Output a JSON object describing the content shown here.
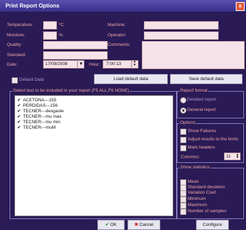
{
  "window": {
    "title": "Print Report Options",
    "close": "x"
  },
  "form": {
    "temperature_label": "Temperature:",
    "temperature_unit": "ºC",
    "moisture_label": "Moisture:",
    "moisture_unit": "%",
    "quality_label": "Quality:",
    "standard_label": "Standard:",
    "date_label": "Date:",
    "date_value": "17/09/2008",
    "hour_label": "Hour:",
    "hour_value": "7:00:13",
    "machine_label": "Machine:",
    "operator_label": "Operator:",
    "comments_label": "Comments:"
  },
  "defaults": {
    "default_data_label": "Default Data",
    "load_label": "Load default data",
    "save_label": "Save default data"
  },
  "tests": {
    "title": "Select test to be included in your report (F5 ALL,F6 NONE)",
    "items": [
      "ACETONA---155",
      "PERDIDAS---156",
      "TECNER---desgaste",
      "TECNER---mu max",
      "TECNER---mu min",
      "TECNER---muM"
    ]
  },
  "report_format": {
    "title": "Report format",
    "detailed": "Detailed report",
    "general": "General report"
  },
  "options": {
    "title": "Options",
    "show_failures": "Show Failures",
    "adjust": "Adjust results to the limits",
    "mark_headers": "Mark headers",
    "columns_label": "Columns:",
    "columns_value": "11"
  },
  "statistics": {
    "title": "Show statistics",
    "items": [
      "Mean",
      "Standard deviation",
      "Variation Coef.",
      "Minimum",
      "Maximum",
      "Number of samples"
    ]
  },
  "footer": {
    "ok": "OK",
    "cancel": "Cancel",
    "configure": "Configure"
  }
}
